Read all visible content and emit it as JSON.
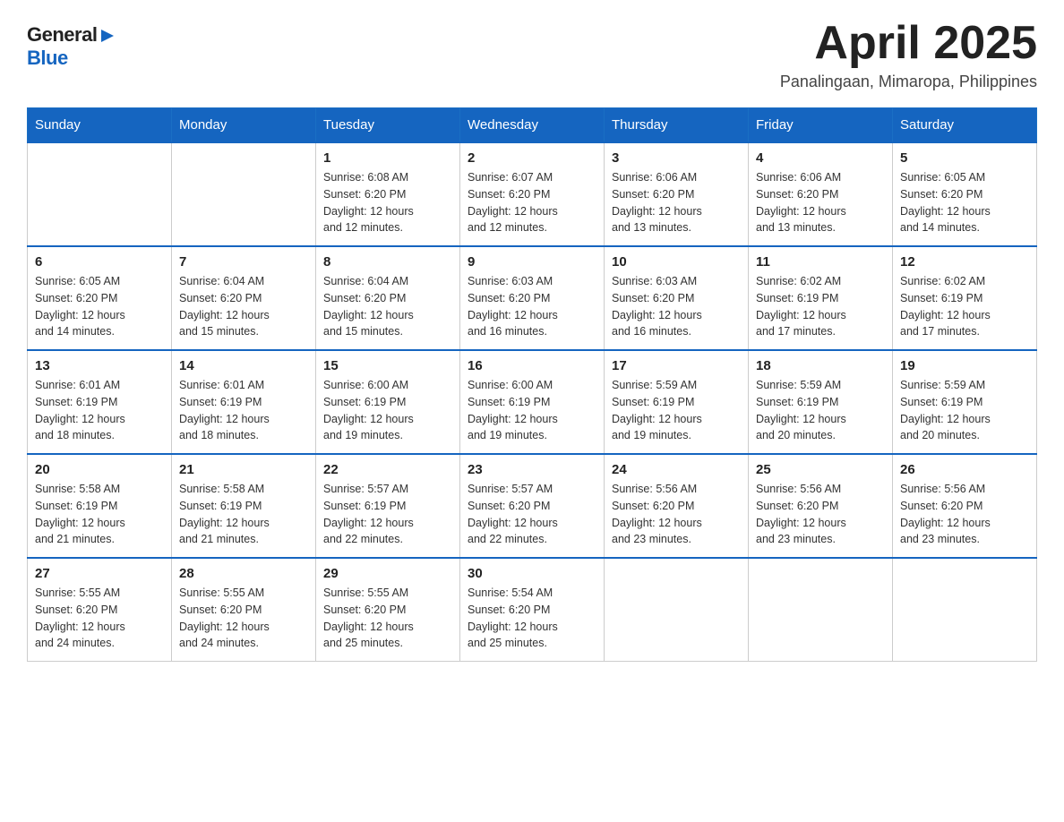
{
  "header": {
    "logo": {
      "text_general": "General",
      "triangle": "▶",
      "text_blue": "Blue"
    },
    "title": "April 2025",
    "location": "Panalingaan, Mimaropa, Philippines"
  },
  "days_of_week": [
    "Sunday",
    "Monday",
    "Tuesday",
    "Wednesday",
    "Thursday",
    "Friday",
    "Saturday"
  ],
  "weeks": [
    [
      {
        "day": "",
        "info": ""
      },
      {
        "day": "",
        "info": ""
      },
      {
        "day": "1",
        "info": "Sunrise: 6:08 AM\nSunset: 6:20 PM\nDaylight: 12 hours\nand 12 minutes."
      },
      {
        "day": "2",
        "info": "Sunrise: 6:07 AM\nSunset: 6:20 PM\nDaylight: 12 hours\nand 12 minutes."
      },
      {
        "day": "3",
        "info": "Sunrise: 6:06 AM\nSunset: 6:20 PM\nDaylight: 12 hours\nand 13 minutes."
      },
      {
        "day": "4",
        "info": "Sunrise: 6:06 AM\nSunset: 6:20 PM\nDaylight: 12 hours\nand 13 minutes."
      },
      {
        "day": "5",
        "info": "Sunrise: 6:05 AM\nSunset: 6:20 PM\nDaylight: 12 hours\nand 14 minutes."
      }
    ],
    [
      {
        "day": "6",
        "info": "Sunrise: 6:05 AM\nSunset: 6:20 PM\nDaylight: 12 hours\nand 14 minutes."
      },
      {
        "day": "7",
        "info": "Sunrise: 6:04 AM\nSunset: 6:20 PM\nDaylight: 12 hours\nand 15 minutes."
      },
      {
        "day": "8",
        "info": "Sunrise: 6:04 AM\nSunset: 6:20 PM\nDaylight: 12 hours\nand 15 minutes."
      },
      {
        "day": "9",
        "info": "Sunrise: 6:03 AM\nSunset: 6:20 PM\nDaylight: 12 hours\nand 16 minutes."
      },
      {
        "day": "10",
        "info": "Sunrise: 6:03 AM\nSunset: 6:20 PM\nDaylight: 12 hours\nand 16 minutes."
      },
      {
        "day": "11",
        "info": "Sunrise: 6:02 AM\nSunset: 6:19 PM\nDaylight: 12 hours\nand 17 minutes."
      },
      {
        "day": "12",
        "info": "Sunrise: 6:02 AM\nSunset: 6:19 PM\nDaylight: 12 hours\nand 17 minutes."
      }
    ],
    [
      {
        "day": "13",
        "info": "Sunrise: 6:01 AM\nSunset: 6:19 PM\nDaylight: 12 hours\nand 18 minutes."
      },
      {
        "day": "14",
        "info": "Sunrise: 6:01 AM\nSunset: 6:19 PM\nDaylight: 12 hours\nand 18 minutes."
      },
      {
        "day": "15",
        "info": "Sunrise: 6:00 AM\nSunset: 6:19 PM\nDaylight: 12 hours\nand 19 minutes."
      },
      {
        "day": "16",
        "info": "Sunrise: 6:00 AM\nSunset: 6:19 PM\nDaylight: 12 hours\nand 19 minutes."
      },
      {
        "day": "17",
        "info": "Sunrise: 5:59 AM\nSunset: 6:19 PM\nDaylight: 12 hours\nand 19 minutes."
      },
      {
        "day": "18",
        "info": "Sunrise: 5:59 AM\nSunset: 6:19 PM\nDaylight: 12 hours\nand 20 minutes."
      },
      {
        "day": "19",
        "info": "Sunrise: 5:59 AM\nSunset: 6:19 PM\nDaylight: 12 hours\nand 20 minutes."
      }
    ],
    [
      {
        "day": "20",
        "info": "Sunrise: 5:58 AM\nSunset: 6:19 PM\nDaylight: 12 hours\nand 21 minutes."
      },
      {
        "day": "21",
        "info": "Sunrise: 5:58 AM\nSunset: 6:19 PM\nDaylight: 12 hours\nand 21 minutes."
      },
      {
        "day": "22",
        "info": "Sunrise: 5:57 AM\nSunset: 6:19 PM\nDaylight: 12 hours\nand 22 minutes."
      },
      {
        "day": "23",
        "info": "Sunrise: 5:57 AM\nSunset: 6:20 PM\nDaylight: 12 hours\nand 22 minutes."
      },
      {
        "day": "24",
        "info": "Sunrise: 5:56 AM\nSunset: 6:20 PM\nDaylight: 12 hours\nand 23 minutes."
      },
      {
        "day": "25",
        "info": "Sunrise: 5:56 AM\nSunset: 6:20 PM\nDaylight: 12 hours\nand 23 minutes."
      },
      {
        "day": "26",
        "info": "Sunrise: 5:56 AM\nSunset: 6:20 PM\nDaylight: 12 hours\nand 23 minutes."
      }
    ],
    [
      {
        "day": "27",
        "info": "Sunrise: 5:55 AM\nSunset: 6:20 PM\nDaylight: 12 hours\nand 24 minutes."
      },
      {
        "day": "28",
        "info": "Sunrise: 5:55 AM\nSunset: 6:20 PM\nDaylight: 12 hours\nand 24 minutes."
      },
      {
        "day": "29",
        "info": "Sunrise: 5:55 AM\nSunset: 6:20 PM\nDaylight: 12 hours\nand 25 minutes."
      },
      {
        "day": "30",
        "info": "Sunrise: 5:54 AM\nSunset: 6:20 PM\nDaylight: 12 hours\nand 25 minutes."
      },
      {
        "day": "",
        "info": ""
      },
      {
        "day": "",
        "info": ""
      },
      {
        "day": "",
        "info": ""
      }
    ]
  ]
}
